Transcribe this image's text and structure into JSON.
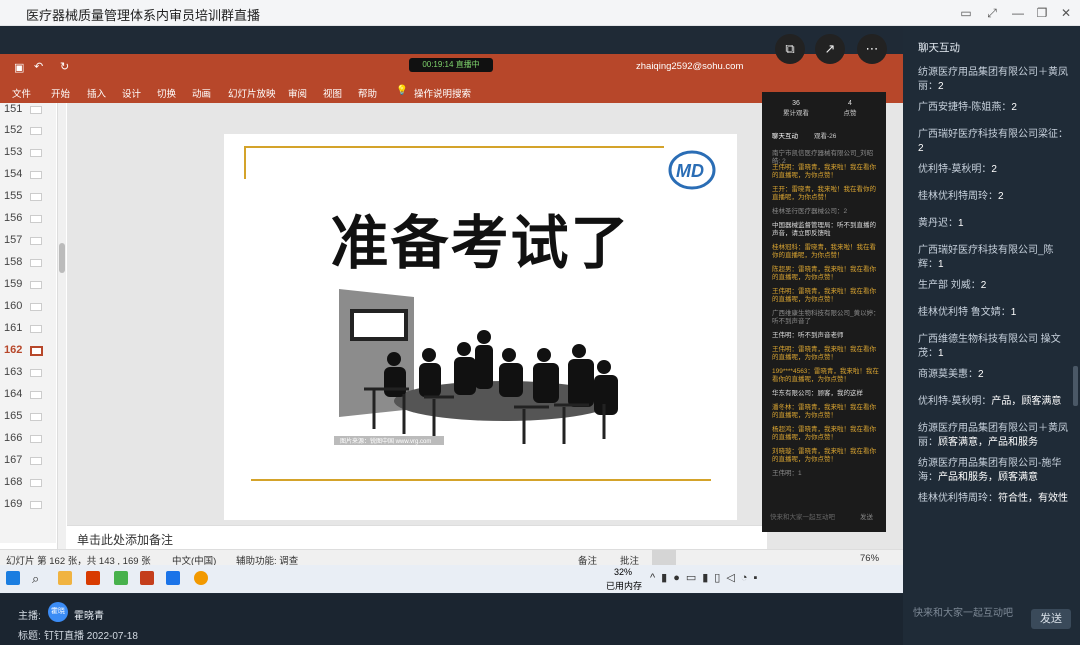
{
  "window": {
    "title": "医疗器械质量管理体系内审员培训群直播"
  },
  "ppt": {
    "tabs": [
      "文件",
      "开始",
      "插入",
      "设计",
      "切换",
      "动画",
      "幻灯片放映",
      "审阅",
      "视图",
      "帮助"
    ],
    "search_hint": "操作说明搜索",
    "user_email": "zhaiqing2592@sohu.com",
    "thumb_numbers": [
      "151",
      "152",
      "153",
      "154",
      "155",
      "156",
      "157",
      "158",
      "159",
      "160",
      "161",
      "162",
      "163",
      "164",
      "165",
      "166",
      "167",
      "168",
      "169"
    ],
    "active_slide": "162",
    "notes_placeholder": "单击此处添加备注",
    "status": {
      "slide_info": "幻灯片 第 162 张，共 143 , 169 张",
      "language": "中文(中国)",
      "accessibility": "辅助功能: 调查",
      "notes_btn": "备注",
      "comments_btn": "批注",
      "zoom": "76%"
    }
  },
  "slide": {
    "title": "准备考试了",
    "watermark": "图片来源：锐图中国 www.vrg.com"
  },
  "live_pill": {
    "time": "00:19:14",
    "label": "直播中"
  },
  "taskbar": {
    "memory_pct": "32%",
    "memory_label": "已用内存"
  },
  "overlay_chat": {
    "stats": [
      {
        "value": "36",
        "label": "累计观看"
      },
      {
        "value": "4",
        "label": "点赞"
      }
    ],
    "tabs": [
      "聊天互动",
      "观看-26"
    ],
    "messages": [
      {
        "text": "南宁市凯信医疗器械有限公司_刘昭皓: 2",
        "style": "grey"
      },
      {
        "text": "王伟明：雷晓青，我来啦！我在看你的直播呢，为你点赞！",
        "style": "orange"
      },
      {
        "text": "王开：雷晓青，我来啦！我在看你的直播呢，为你点赞！",
        "style": "orange"
      },
      {
        "text": "桂林圣行医疗器械公司：2",
        "style": "grey"
      },
      {
        "text": "中国器械监督管理局：听不到直播的声音，请立即反馈啦",
        "style": "white"
      },
      {
        "text": "桂林冠科：雷晓青，我来啦！我在看你的直播呢，为你点赞！",
        "style": "orange"
      },
      {
        "text": "陈超男：雷晓青，我来啦！我在看你的直播呢，为你点赞！",
        "style": "orange"
      },
      {
        "text": "王伟明：雷晓青，我来啦！我在看你的直播呢，为你点赞！",
        "style": "orange"
      },
      {
        "text": "广西维康生物科技有限公司_黄以婷：听不到声音了",
        "style": "grey"
      },
      {
        "text": "王伟明：听不到声音老师",
        "style": "white"
      },
      {
        "text": "王伟明：雷晓青，我来啦！我在看你的直播呢，为你点赞！",
        "style": "orange"
      },
      {
        "text": "199****4563：雷晓青，我来啦！我在看你的直播呢，为你点赞！",
        "style": "orange"
      },
      {
        "text": "华东有限公司：顾客，我的这样",
        "style": "white"
      },
      {
        "text": "潘冬林：雷晓青，我来啦！我在看你的直播呢，为你点赞！",
        "style": "orange"
      },
      {
        "text": "杨超鸿：雷晓青，我来啦！我在看你的直播呢，为你点赞！",
        "style": "orange"
      },
      {
        "text": "刘晓璇：雷晓青，我来啦！我在看你的直播呢，为你点赞！",
        "style": "orange"
      },
      {
        "text": "王伟明：1",
        "style": "grey"
      }
    ],
    "input_placeholder": "快来和大家一起互动吧",
    "send": "发送"
  },
  "chat_panel": {
    "title": "聊天互动",
    "messages": [
      {
        "sender": "纺源医疗用品集团有限公司＋黄凤丽：",
        "content": "2"
      },
      {
        "sender": "广西安捷特-陈姐燕：",
        "content": "2"
      },
      {
        "sender": "广西瑞好医疗科技有限公司梁征：",
        "content": "2"
      },
      {
        "sender": "优利特-莫秋明：",
        "content": "2"
      },
      {
        "sender": "桂林优利特周玲：",
        "content": "2"
      },
      {
        "sender": "黄丹迟：",
        "content": "1"
      },
      {
        "sender": "广西瑞好医疗科技有限公司_陈辉：",
        "content": "1"
      },
      {
        "sender": "生产部 刘威：",
        "content": "2"
      },
      {
        "sender": "桂林优利特 鲁文婧：",
        "content": "1"
      },
      {
        "sender": "广西维德生物科技有限公司 操文茂：",
        "content": "1"
      },
      {
        "sender": "商源莫美惠：",
        "content": "2"
      },
      {
        "sender": "优利特-莫秋明：",
        "content": "产品，顾客满意"
      },
      {
        "sender": "纺源医疗用品集团有限公司＋黄凤丽：",
        "content": "顾客满意，产品和服务"
      },
      {
        "sender": "纺源医疗用品集团有限公司-施华海：",
        "content": "产品和服务，顾客满意"
      },
      {
        "sender": "桂林优利特周玲：",
        "content": "符合性，有效性"
      }
    ],
    "input_placeholder": "快来和大家一起互动吧",
    "send_label": "发送"
  },
  "footer": {
    "host_label": "主播:",
    "host_avatar": "霍晓",
    "host_name": "霍晓青",
    "topic_label": "标题:",
    "topic": "钉钉直播 2022-07-18"
  },
  "colors": {
    "ppt_accent": "#b7472a",
    "panel_bg": "#1f2b37",
    "chat_highlight": "#d9a431"
  }
}
